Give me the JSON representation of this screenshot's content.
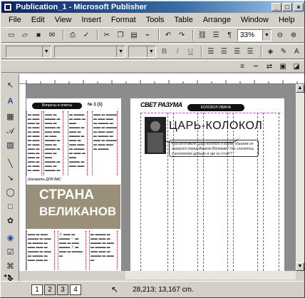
{
  "window": {
    "title": "Publication_1 - Microsoft Publisher",
    "minimize": "_",
    "maximize": "□",
    "close": "×"
  },
  "menu": [
    "File",
    "Edit",
    "View",
    "Insert",
    "Format",
    "Tools",
    "Table",
    "Arrange",
    "Window",
    "Help"
  ],
  "toolbar": {
    "zoom": "33%",
    "pilcrow": "¶",
    "bold": "B",
    "italic": "I",
    "underline": "U"
  },
  "document": {
    "left_header": "Вопросы и ответы",
    "left_issue": "№ 1 (1)",
    "left_label": "Шахматы ДЛЯ ВАС",
    "banner_line1": "СТРАНА",
    "banner_line2": "ВЕЛИКАНОВ",
    "right_masthead": "СВЕТ РАЗУМА",
    "right_pill": "КОЛОКОЛ ИВАНА",
    "headline": "ЦАРЬ-КОЛОКОЛ",
    "lead": "Как изготовили царь-колокол и каким образом он оказался перед Иваном Великим? Что случилось с колоколом дальше и где он стоит?"
  },
  "status": {
    "pages": [
      "1",
      "2",
      "3",
      "4"
    ],
    "active_page": "1",
    "coordinates": "28,213; 13,167 cm."
  }
}
